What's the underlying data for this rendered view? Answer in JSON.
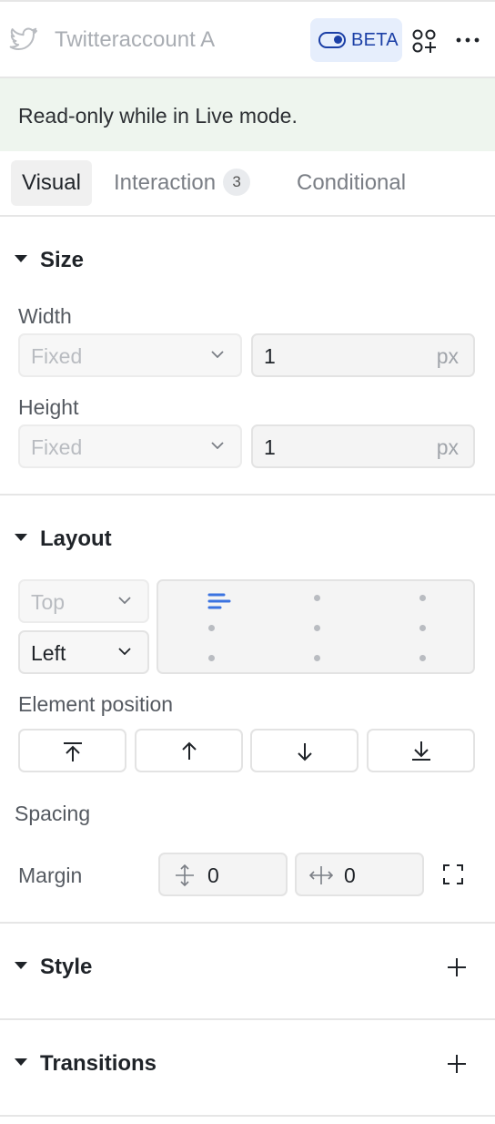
{
  "header": {
    "title": "Twitteraccount A",
    "beta_label": "BETA",
    "icons": [
      "twitter-icon",
      "toggle-icon",
      "add-component-icon",
      "more-options-icon"
    ]
  },
  "banner": {
    "text": "Read-only while in Live mode."
  },
  "tabs": [
    {
      "label": "Visual",
      "active": true
    },
    {
      "label": "Interaction",
      "badge": "3"
    },
    {
      "label": "Conditional"
    }
  ],
  "size": {
    "title": "Size",
    "width": {
      "label": "Width",
      "mode": "Fixed",
      "value": "1",
      "unit": "px"
    },
    "height": {
      "label": "Height",
      "mode": "Fixed",
      "value": "1",
      "unit": "px"
    }
  },
  "layout": {
    "title": "Layout",
    "vertical": "Top",
    "horizontal": "Left",
    "element_position_label": "Element position",
    "spacing_label": "Spacing",
    "margin_label": "Margin",
    "margin_vertical": "0",
    "margin_horizontal": "0"
  },
  "style": {
    "title": "Style"
  },
  "transitions": {
    "title": "Transitions"
  },
  "colors": {
    "accent": "#1b3fa6",
    "beta_bg": "#e6eefc",
    "banner_bg": "#eef5ee",
    "align_accent": "#3b73e0"
  }
}
